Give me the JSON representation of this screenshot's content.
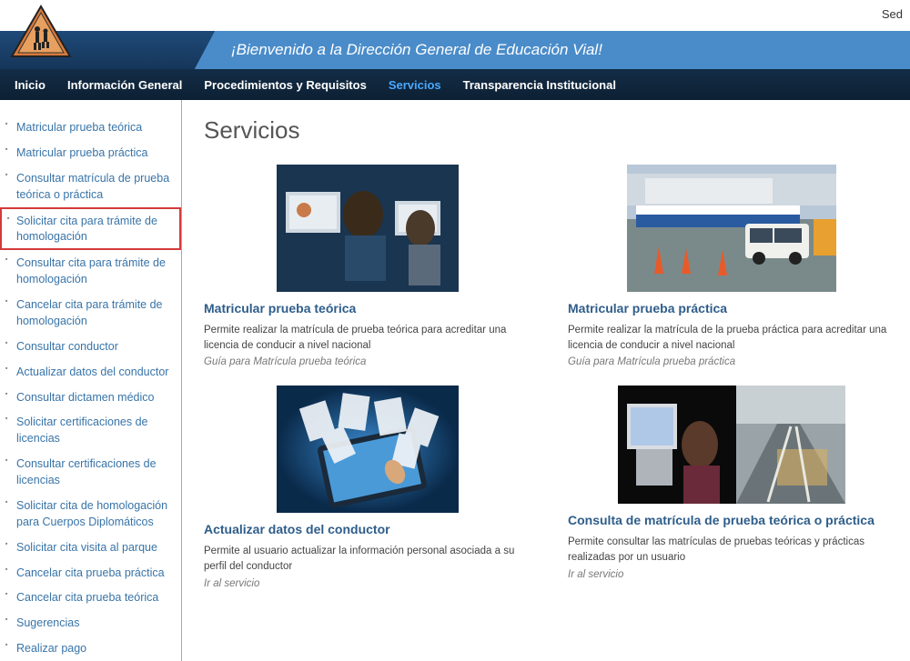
{
  "top_right": "Sed",
  "header": {
    "welcome": "¡Bienvenido a la Dirección General de Educación Vial!"
  },
  "nav": {
    "items": [
      {
        "label": "Inicio",
        "active": false
      },
      {
        "label": "Información General",
        "active": false
      },
      {
        "label": "Procedimientos y Requisitos",
        "active": false
      },
      {
        "label": "Servicios",
        "active": true
      },
      {
        "label": "Transparencia Institucional",
        "active": false
      }
    ]
  },
  "sidebar": {
    "items": [
      {
        "label": "Matricular prueba teórica",
        "highlighted": false
      },
      {
        "label": "Matricular prueba práctica",
        "highlighted": false
      },
      {
        "label": "Consultar matrícula de prueba teórica o práctica",
        "highlighted": false
      },
      {
        "label": "Solicitar cita para trámite de homologación",
        "highlighted": true
      },
      {
        "label": "Consultar cita para trámite de homologación",
        "highlighted": false
      },
      {
        "label": "Cancelar cita para trámite de homologación",
        "highlighted": false
      },
      {
        "label": "Consultar conductor",
        "highlighted": false
      },
      {
        "label": "Actualizar datos del conductor",
        "highlighted": false
      },
      {
        "label": "Consultar dictamen médico",
        "highlighted": false
      },
      {
        "label": "Solicitar certificaciones de licencias",
        "highlighted": false
      },
      {
        "label": "Consultar certificaciones de licencias",
        "highlighted": false
      },
      {
        "label": "Solicitar cita de homologación para Cuerpos Diplomáticos",
        "highlighted": false
      },
      {
        "label": "Solicitar cita visita al parque",
        "highlighted": false
      },
      {
        "label": "Cancelar cita prueba práctica",
        "highlighted": false
      },
      {
        "label": "Cancelar cita prueba teórica",
        "highlighted": false
      },
      {
        "label": "Sugerencias",
        "highlighted": false
      },
      {
        "label": "Realizar pago",
        "highlighted": false
      }
    ]
  },
  "main": {
    "title": "Servicios",
    "services": [
      {
        "img": "exam-room",
        "title": "Matricular prueba teórica",
        "desc": "Permite realizar la matrícula de prueba teórica para acreditar una licencia de conducir a nivel nacional",
        "guide": "Guía para Matrícula prueba teórica"
      },
      {
        "img": "driving-course",
        "title": "Matricular prueba práctica",
        "desc": "Permite realizar la matrícula de la prueba práctica para acreditar una licencia de conducir a nivel nacional",
        "guide": "Guía para Matrícula prueba práctica"
      },
      {
        "img": "tablet-docs",
        "title": "Actualizar datos del conductor",
        "desc": "Permite al usuario actualizar la información personal asociada a su perfil del conductor",
        "guide": "Ir al servicio"
      },
      {
        "img": "office-road",
        "title": "Consulta de matrícula de prueba teórica o práctica",
        "desc": "Permite consultar las matrículas de pruebas teóricas y prácticas realizadas por un usuario",
        "guide": "Ir al servicio"
      }
    ]
  }
}
